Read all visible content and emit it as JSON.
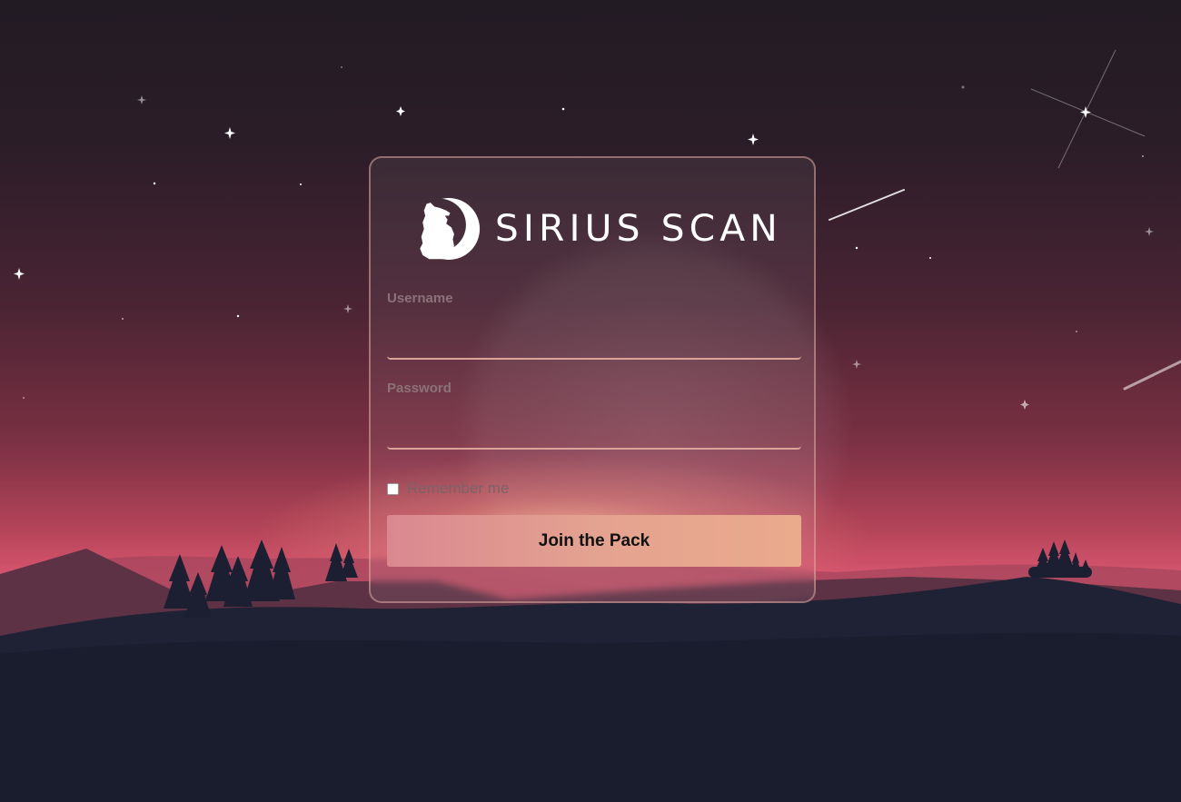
{
  "brand": {
    "logo_text": "SIRIUS SCAN",
    "logo_icon": "howling-wolf-moon-icon"
  },
  "form": {
    "username_label": "Username",
    "username_value": "",
    "password_label": "Password",
    "password_value": "",
    "remember_label": "Remember me",
    "remember_checked": false,
    "submit_label": "Join the Pack"
  },
  "colors": {
    "sky_top": "#221b24",
    "sky_mid": "#6a2c3e",
    "horizon": "#d44f6e",
    "ground": "#191d2d",
    "button_start": "#d98890",
    "button_end": "#eaaa8c",
    "input_underline": "#d9a49a"
  }
}
